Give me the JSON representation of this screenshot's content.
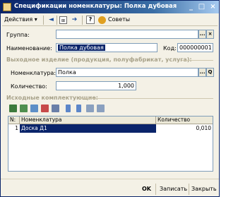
{
  "window": {
    "title": "Спецификации номенклатуры: Полка дубовая",
    "min_label": "_",
    "max_label": "□",
    "close_label": "×"
  },
  "toolbar": {
    "actions_label": "Действия ▾",
    "help_label": "?",
    "advice_label": "Советы"
  },
  "form": {
    "group_label": "Группа:",
    "group_value": "",
    "name_label": "Наименование:",
    "name_value": "Полка дубовая",
    "code_label": "Код:",
    "code_value": "000000001",
    "select_btn": "...",
    "clear_btn": "×",
    "open_btn": "Q"
  },
  "output": {
    "section_title": "Выходное изделие (продукция, полуфабрикат, услуга):",
    "nomenclature_label": "Номенклатура:",
    "nomenclature_value": "Полка",
    "quantity_label": "Количество:",
    "quantity_value": "1,000"
  },
  "components": {
    "section_title": "Исходные комплектующие:",
    "columns": [
      "N:",
      "Номенклатура",
      "Количество"
    ],
    "rows": [
      {
        "n": "1",
        "name": "Доска Д1",
        "qty": "0,010"
      }
    ]
  },
  "bottom": {
    "ok_label": "OK",
    "save_label": "Записать",
    "close_label": "Закрыть"
  },
  "colors": {
    "title_bar": "#0a246a",
    "selection": "#0a246a",
    "window_bg": "#f4f1e6",
    "field_border": "#7f9db9",
    "section_title": "#a8a28a"
  }
}
